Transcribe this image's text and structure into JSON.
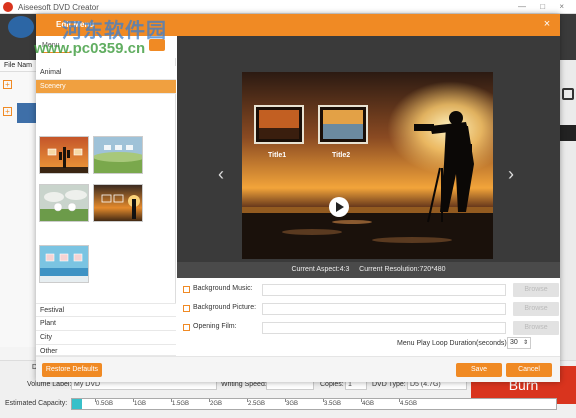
{
  "app": {
    "title": "Aiseesoft DVD Creator",
    "window_controls": "— □ ×",
    "file_name_header": "File Nam",
    "bottom": {
      "volume_label": "Volume Label:",
      "volume_value": "My DVD",
      "writing_speed_label": "Writing Speed:",
      "copies_label": "Copies:",
      "copies_value": "1",
      "dvd_type_label": "DVD Type:",
      "dvd_type_value": "D5 (4.7G)",
      "estimated_capacity_label": "Estimated Capacity:",
      "capacity_ticks": [
        "0.5GB",
        "1GB",
        "1.5GB",
        "2GB",
        "2.5GB",
        "3GB",
        "3.5GB",
        "4GB",
        "4.5GB"
      ],
      "capacity_fraction": 0.02,
      "burn_label": "Burn",
      "partial_d": "D"
    }
  },
  "modal": {
    "title": "Edit Menu",
    "close_icon": "×",
    "menu_tab": "Menu",
    "categories_top": [
      {
        "label": "Animal",
        "active": false
      },
      {
        "label": "Scenery",
        "active": true
      }
    ],
    "categories_bottom": [
      {
        "label": "Festival"
      },
      {
        "label": "Plant"
      },
      {
        "label": "City"
      },
      {
        "label": "Other"
      }
    ],
    "preview": {
      "title1": "Title1",
      "title2": "Title2",
      "left_arrow": "‹",
      "right_arrow": "›"
    },
    "status": {
      "aspect_label": "Current Aspect:",
      "aspect_value": "4:3",
      "resolution_label": "Current Resolution:",
      "resolution_value": "720*480"
    },
    "options": {
      "background_music": "Background Music:",
      "background_picture": "Background Picture:",
      "opening_film": "Opening Film:",
      "browse": "Browse",
      "loop_label": "Menu Play Loop Duration(seconds):",
      "loop_value": "30"
    },
    "footer": {
      "restore": "Restore Defaults",
      "save": "Save",
      "cancel": "Cancel"
    }
  },
  "watermark": {
    "cn": "河东软件园",
    "url": "www.pc0359.cn"
  },
  "colors": {
    "accent": "#f08a24",
    "burn": "#d9341e",
    "capacity": "#38c0c9"
  }
}
